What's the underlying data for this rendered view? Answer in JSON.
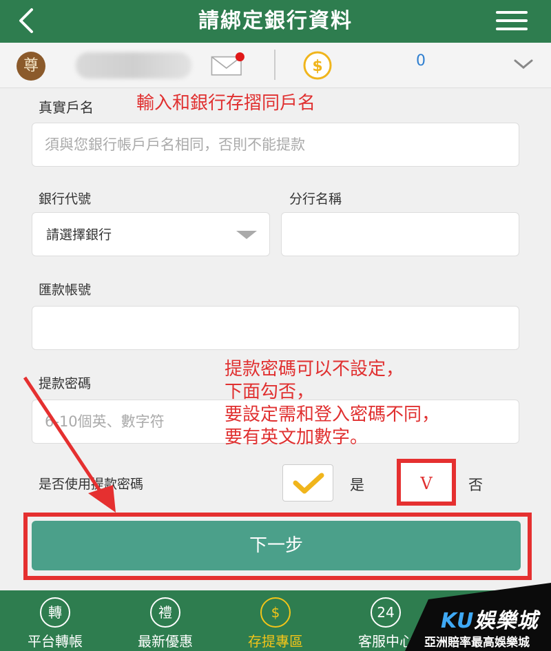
{
  "header": {
    "title": "請綁定銀行資料"
  },
  "user": {
    "vip_badge": "尊",
    "balance": "0"
  },
  "form": {
    "real_name": {
      "label": "真實戶名",
      "placeholder": "須與您銀行帳戶戶名相同，否則不能提款"
    },
    "bank_code": {
      "label": "銀行代號",
      "selected": "請選擇銀行"
    },
    "branch": {
      "label": "分行名稱"
    },
    "account": {
      "label": "匯款帳號"
    },
    "password": {
      "label": "提款密碼",
      "placeholder": "6-10個英、數字符"
    },
    "use_password": {
      "label": "是否使用提款密碼",
      "yes": "是",
      "no": "否",
      "no_mark": "V"
    },
    "next": "下一步"
  },
  "annotations": {
    "name_note": "輸入和銀行存摺同戶名",
    "pw_note": [
      "提款密碼可以不設定，",
      "下面勾否，",
      "要設定需和登入密碼不同，",
      "要有英文加數字。"
    ]
  },
  "nav": [
    {
      "icon": "轉",
      "label": "平台轉帳"
    },
    {
      "icon": "禮",
      "label": "最新優惠"
    },
    {
      "icon": "$",
      "label": "存提專區"
    },
    {
      "icon": "24",
      "label": "客服中心"
    }
  ],
  "promo": {
    "brand_ku": "KU",
    "brand_rest": "娛樂城",
    "tagline": "亞洲賠率最高娛樂城"
  },
  "colors": {
    "header_green": "#2e7d4f",
    "button_teal": "#4ba08a",
    "annotation_red": "#e03030",
    "active_yellow": "#f3c519"
  }
}
